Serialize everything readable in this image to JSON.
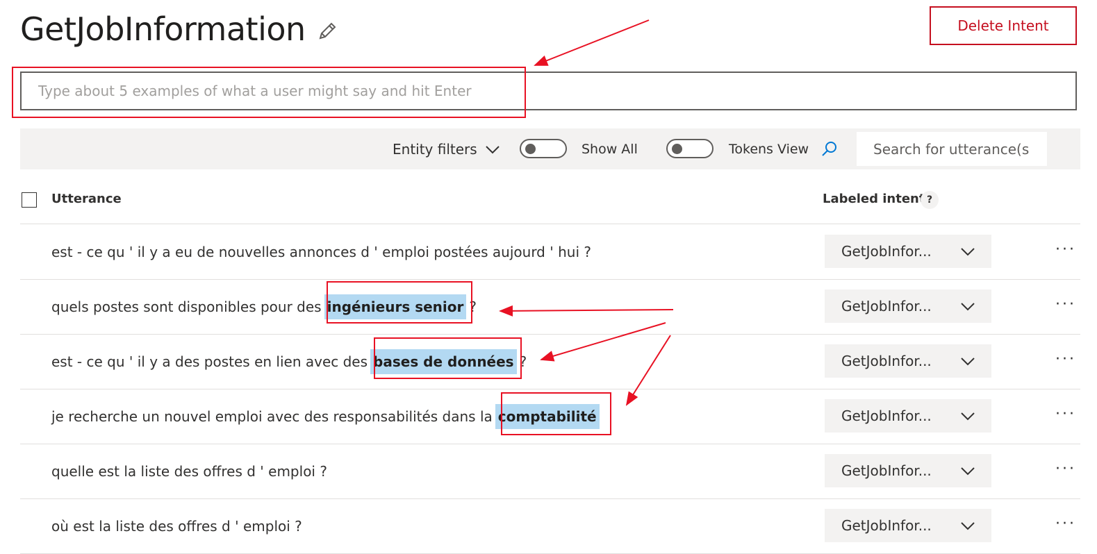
{
  "header": {
    "title": "GetJobInformation",
    "delete_label": "Delete Intent"
  },
  "example_input": {
    "placeholder": "Type about 5 examples of what a user might say and hit Enter"
  },
  "toolbar": {
    "entity_filters_label": "Entity filters",
    "show_all_label": "Show All",
    "tokens_view_label": "Tokens View",
    "search_placeholder": "Search for utterance(s"
  },
  "table": {
    "utterance_header": "Utterance",
    "intent_header": "Labeled intent",
    "help_label": "?",
    "more_label": "···",
    "rows": [
      {
        "before": "est - ce qu ' il y a eu de nouvelles annonces d ' emploi postées aujourd ' hui ?",
        "entity": "",
        "after": "",
        "intent": "GetJobInfor..."
      },
      {
        "before": "quels postes sont disponibles pour des",
        "entity": "ingénieurs senior",
        "after": "?",
        "intent": "GetJobInfor..."
      },
      {
        "before": "est - ce qu ' il y a des postes en lien avec des",
        "entity": "bases de données",
        "after": "?",
        "intent": "GetJobInfor..."
      },
      {
        "before": "je recherche un nouvel emploi avec des responsabilités dans la",
        "entity": "comptabilité",
        "after": "",
        "intent": "GetJobInfor..."
      },
      {
        "before": "quelle est la liste des offres d ' emploi ?",
        "entity": "",
        "after": "",
        "intent": "GetJobInfor..."
      },
      {
        "before": "où est la liste des offres d ' emploi ?",
        "entity": "",
        "after": "",
        "intent": "GetJobInfor..."
      }
    ]
  },
  "colors": {
    "accent": "#c50f1f",
    "annotation": "#e81123",
    "entity_highlight": "#b3d9f2"
  }
}
